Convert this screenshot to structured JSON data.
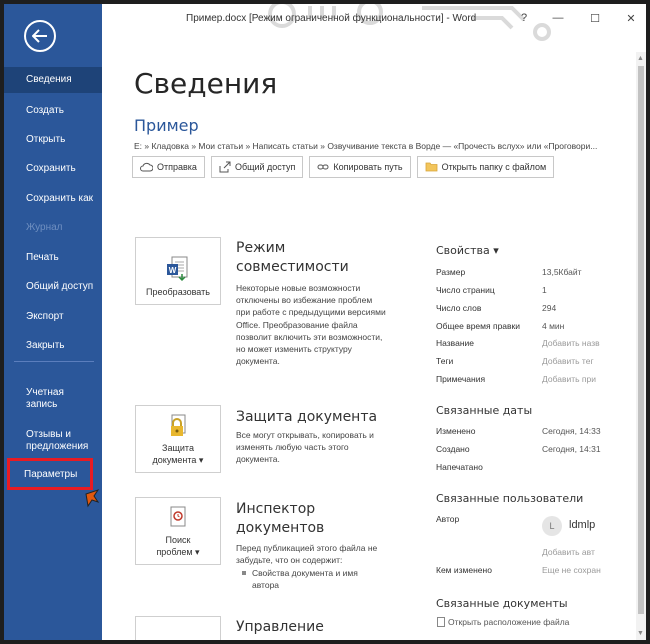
{
  "window": {
    "title": "Пример.docx [Режим ограниченной функциональности]  -  Word",
    "help": "?",
    "minimize": "—",
    "restore": "☐",
    "close": "✕"
  },
  "sidebar": {
    "back_icon": "arrow-left-icon",
    "items": [
      {
        "label": "Сведения",
        "active": true
      },
      {
        "label": "Создать"
      },
      {
        "label": "Открыть"
      },
      {
        "label": "Сохранить"
      },
      {
        "label": "Сохранить как"
      },
      {
        "label": "Журнал",
        "disabled": true
      },
      {
        "label": "Печать"
      },
      {
        "label": "Общий доступ"
      },
      {
        "label": "Экспорт"
      },
      {
        "label": "Закрыть"
      },
      {
        "label": "Учетная\nзапись"
      },
      {
        "label": "Отзывы и\nпредложения"
      }
    ],
    "params": "Параметры"
  },
  "main": {
    "title": "Сведения",
    "doc_name": "Пример",
    "path": "E: » Кладовка » Мои статьи » Написать статьи » Озвучивание текста в Ворде — «Прочесть вслух» или «Проговори...",
    "actions": [
      "Отправка",
      "Общий доступ",
      "Копировать путь",
      "Открыть папку с файлом"
    ],
    "sections": [
      {
        "button": "Преобразовать",
        "title": "Режим\nсовместимости",
        "desc": "Некоторые новые возможности отключены во избежание проблем при работе с предыдущими версиями Office. Преобразование файла позволит включить эти возможности, но может изменить структуру документа."
      },
      {
        "button": "Защита\nдокумента ▾",
        "title": "Защита документа",
        "desc": "Все могут открывать, копировать и изменять любую часть этого документа."
      },
      {
        "button": "Поиск\nпроблем ▾",
        "title": "Инспектор\nдокументов",
        "desc": "Перед публикацией этого файла не забудьте, что он содержит:",
        "bullet": "Свойства документа и имя\nавтора"
      },
      {
        "title": "Управление"
      }
    ]
  },
  "properties": {
    "heading": "Свойства ▾",
    "rows": [
      {
        "label": "Размер",
        "value": "13,5Кбайт"
      },
      {
        "label": "Число страниц",
        "value": "1"
      },
      {
        "label": "Число слов",
        "value": "294"
      },
      {
        "label": "Общее время правки",
        "value": "4 мин"
      },
      {
        "label": "Название",
        "value": "Добавить назв",
        "placeholder": true
      },
      {
        "label": "Теги",
        "value": "Добавить тег",
        "placeholder": true
      },
      {
        "label": "Примечания",
        "value": "Добавить при",
        "placeholder": true
      }
    ],
    "dates_heading": "Связанные даты",
    "dates": [
      {
        "label": "Изменено",
        "value": "Сегодня, 14:33"
      },
      {
        "label": "Создано",
        "value": "Сегодня, 14:31"
      },
      {
        "label": "Напечатано",
        "value": ""
      }
    ],
    "people_heading": "Связанные пользователи",
    "author_label": "Автор",
    "author_initial": "L",
    "author_name": "ldmlp",
    "add_author": "Добавить авт",
    "modified_by_label": "Кем изменено",
    "modified_by_value": "Еще не сохран",
    "docs_heading": "Связанные документы",
    "open_location": "Открыть расположение файла"
  },
  "colors": {
    "sidebar": "#2b579a",
    "accent": "#2b579a",
    "highlight": "#e81b23"
  }
}
